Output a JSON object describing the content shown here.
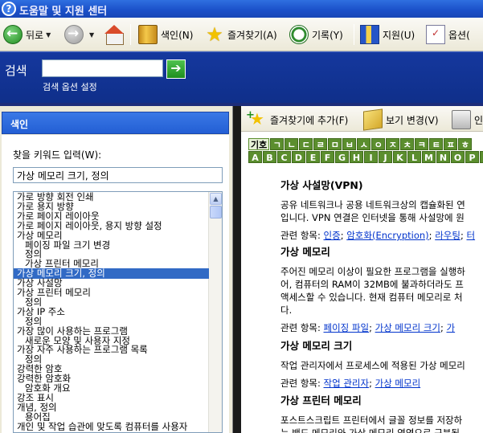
{
  "window": {
    "title": "도움말 및 지원 센터"
  },
  "toolbar": {
    "back": "뒤로",
    "index": "색인(N)",
    "favorites": "즐겨찾기(A)",
    "history": "기록(Y)",
    "support": "지원(U)",
    "options": "옵션("
  },
  "search": {
    "label": "검색",
    "value": "",
    "options_link": "검색 옵션 설정"
  },
  "index_pane": {
    "header": "색인",
    "keyword_label": "찾을 키워드 입력(W):",
    "keyword_value": "가상 메모리 크기, 정의",
    "items": [
      "가로 방향 회전 인쇄",
      "가로 용지 방향",
      "가로 페이지 레이아웃",
      "가로 페이지 레이아웃, 용지 방향 설정",
      "가상 메모리",
      "페이징 파일 크기 변경",
      "정의",
      "가상 프린터 메모리",
      "가상 메모리 크기, 정의",
      "가상 사설망",
      "가상 프린터 메모리",
      "정의",
      "가상 IP 주소",
      "정의",
      "가장 많이 사용하는 프로그램",
      "새로운 모양 및 사용자 지정",
      "가장 자주 사용하는 프로그램 목록",
      "정의",
      "강력한 암호",
      "강력한 암호화",
      "암호화 개요",
      "강조 표시",
      "개념, 정의",
      "용어집",
      "개인 및 작업 습관에 맞도록 컴퓨터를 사용자"
    ],
    "selected_index": 8
  },
  "content_pane": {
    "toolbar": {
      "add_favorite": "즐겨찾기에 추가(F)",
      "change_view": "보기 변경(V)",
      "print": "인"
    },
    "hangul_keys": [
      "기호",
      "ㄱ",
      "ㄴ",
      "ㄷ",
      "ㄹ",
      "ㅁ",
      "ㅂ",
      "ㅅ",
      "ㅇ",
      "ㅈ",
      "ㅊ",
      "ㅋ",
      "ㅌ",
      "ㅍ",
      "ㅎ"
    ],
    "alpha_keys": [
      "A",
      "B",
      "C",
      "D",
      "E",
      "F",
      "G",
      "H",
      "I",
      "J",
      "K",
      "L",
      "M",
      "N",
      "O",
      "P",
      "Q"
    ],
    "topics": [
      {
        "title": "가상 사설망(VPN)",
        "lines": [
          "공유 네트워크나 공용 네트워크상의 캡슐화된 연",
          "입니다. VPN 연결은 인터넷을 통해 사설망에 원"
        ],
        "related_label": "관련 항목:",
        "related": [
          "인증",
          "암호화(Encryption)",
          "라우팅",
          "터"
        ]
      },
      {
        "title": "가상 메모리",
        "lines": [
          "주어진 메모리 이상이 필요한 프로그램을 실행하",
          "어, 컴퓨터의 RAM이 32MB에 불과하더라도 프",
          "액세스할 수 있습니다. 현재 컴퓨터 메모리로 처",
          "다."
        ],
        "related_label": "관련 항목:",
        "related": [
          "페이징 파일",
          "가상 메모리 크기",
          "가"
        ]
      },
      {
        "title": "가상 메모리 크기",
        "lines": [
          "작업 관리자에서 프로세스에 적용된 가상 메모리"
        ],
        "related_label": "관련 항목:",
        "related": [
          "작업 관리자",
          "가상 메모리"
        ]
      },
      {
        "title": "가상 프린터 메모리",
        "lines": [
          "포스트스크립트 프린터에서 글꼴 정보를 저장하",
          "는 밴드 메모리와 가상 메모리 영역으로 구분됩"
        ],
        "related_label": "",
        "related": []
      }
    ]
  },
  "colors": {
    "title_blue": "#1a4fc8",
    "search_blue": "#15389e",
    "selection": "#316ac5",
    "key_green": "#5b8e2e",
    "link": "#0033cc"
  }
}
